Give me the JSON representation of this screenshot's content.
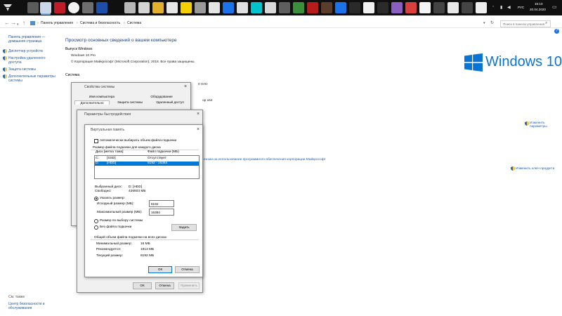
{
  "taskbar": {
    "lang": "РУС",
    "time": "15:10",
    "date": "20.04.2020"
  },
  "addressbar": {
    "crumbs": [
      "Панель управления",
      "Система и безопасность",
      "Система"
    ],
    "search_placeholder": "Поиск в панели управления"
  },
  "sidebar": {
    "home": "Панель управления — домашняя страница",
    "items": [
      "Диспетчер устройств",
      "Настройка удаленного доступа",
      "Защита системы",
      "Дополнительные параметры системы"
    ],
    "see_also": "См. также",
    "security_center": "Центр безопасности и обслуживания"
  },
  "main": {
    "title": "Просмотр основных сведений о вашем компьютере",
    "edition_header": "Выпуск Windows",
    "edition": "Windows 10 Pro",
    "copyright": "© Корпорация Майкрософт (Microsoft Corporation), 2018. Все права защищены.",
    "logo_text": "Windows 10",
    "system_header": "Система",
    "x64_fragment": "ор x64",
    "ghz_fragment": "0 GHz",
    "change_params": "Изменить параметры",
    "license_link": "ензии на использование программного обеспечения корпорации Майкрософт",
    "product_key_link": "Изменить ключ продукта"
  },
  "sysprops": {
    "title": "Свойства системы",
    "tabs_row1": [
      "Имя компьютера",
      "Оборудование"
    ],
    "tabs_row2": [
      "Дополнительно",
      "Защита системы",
      "Удаленный доступ"
    ]
  },
  "perf": {
    "title": "Параметры быстродействия",
    "buttons": {
      "ok": "ОК",
      "cancel": "Отмена",
      "apply": "Применить"
    }
  },
  "vm": {
    "title": "Виртуальная память",
    "auto_label": "Автоматически выбирать объем файла подкачки",
    "group_header": "Размер файла подкачки для каждого диска",
    "col_disk": "Диск [метка тома]",
    "col_size": "Файл подкачки (МБ)",
    "disks": [
      {
        "name": "C:",
        "label": "[SSD]",
        "size": "Отсутствует"
      },
      {
        "name": "D:",
        "label": "[HDD]",
        "size": "8192 - 16384"
      }
    ],
    "selected_disk_label": "Выбранный диск:",
    "selected_disk_value": "D: [HDD]",
    "free_label": "Свободно:",
    "free_value": "426603 МБ",
    "custom_label": "Указать размер:",
    "initial_label": "Исходный размер (МБ):",
    "initial_value": "8192",
    "max_label": "Максимальный размер (МБ):",
    "max_value": "16384",
    "system_managed_label": "Размер по выбору системы",
    "no_file_label": "Без файла подкачки",
    "set_button": "Задать",
    "totals_header": "Общий объем файла подкачки на всех дисках",
    "min_label": "Минимальный размер:",
    "min_value": "16 МБ",
    "recommended_label": "Рекомендуется:",
    "recommended_value": "1913 МБ",
    "current_label": "Текущий размер:",
    "current_value": "8192 МБ",
    "ok": "ОК",
    "cancel": "Отмена"
  }
}
